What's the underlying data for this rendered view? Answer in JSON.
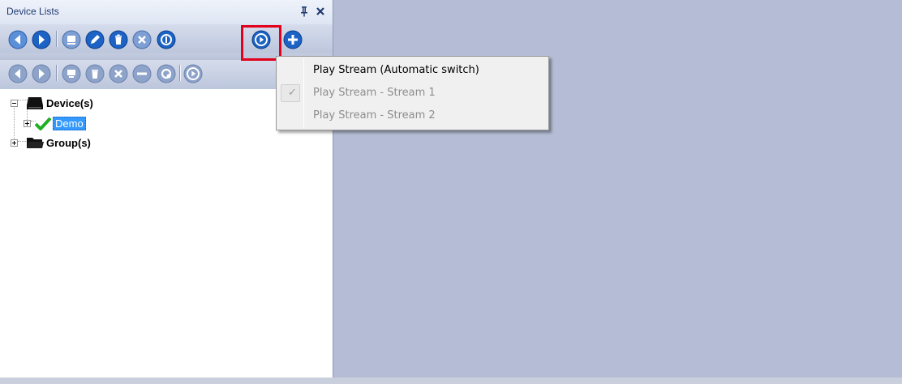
{
  "panel": {
    "title": "Device Lists",
    "pin_icon": "pin-icon",
    "close_icon": "close-icon"
  },
  "toolbar1": {
    "buttons": [
      "back-icon",
      "forward-icon",
      "device-icon",
      "edit-icon",
      "delete-icon",
      "remove-icon",
      "info-icon",
      "play-icon",
      "add-icon"
    ],
    "highlighted": "play-icon",
    "highlight_color": "#e3001b"
  },
  "toolbar2": {
    "buttons": [
      "back-icon",
      "forward-icon",
      "monitor-icon",
      "delete-icon",
      "remove-icon",
      "minus-icon",
      "refresh-icon",
      "play-icon"
    ],
    "disabled": true
  },
  "tree": {
    "devices_label": "Device(s)",
    "device_item_label": "Demo",
    "groups_label": "Group(s)"
  },
  "menu": {
    "items": [
      {
        "label": "Play Stream (Automatic switch)",
        "enabled": true,
        "checked": false
      },
      {
        "label": "Play Stream - Stream 1",
        "enabled": false,
        "checked": true
      },
      {
        "label": "Play Stream - Stream 2",
        "enabled": false,
        "checked": false
      }
    ],
    "check_glyph": "✓"
  },
  "colors": {
    "workspace": "#b4bdd5",
    "title_text": "#1e3970",
    "button_blue": "#1c63c5",
    "button_disabled": "#8ea3c9",
    "selection": "#3399ff",
    "status_ok": "#21b021"
  }
}
